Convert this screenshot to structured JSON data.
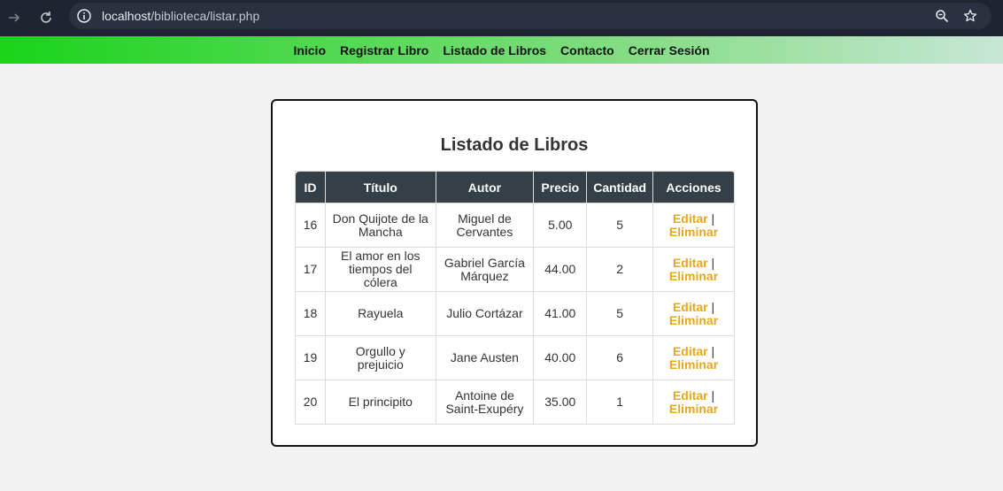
{
  "browser": {
    "url_host": "localhost",
    "url_path": "/biblioteca/listar.php"
  },
  "nav": {
    "items": [
      "Inicio",
      "Registrar Libro",
      "Listado de Libros",
      "Contacto",
      "Cerrar Sesión"
    ]
  },
  "main": {
    "title": "Listado de Libros",
    "columns": [
      "ID",
      "Título",
      "Autor",
      "Precio",
      "Cantidad",
      "Acciones"
    ],
    "rows": [
      {
        "id": "16",
        "titulo": "Don Quijote de la Mancha",
        "autor": "Miguel de Cervantes",
        "precio": "5.00",
        "cantidad": "5"
      },
      {
        "id": "17",
        "titulo": "El amor en los tiempos del cólera",
        "autor": "Gabriel García Márquez",
        "precio": "44.00",
        "cantidad": "2"
      },
      {
        "id": "18",
        "titulo": "Rayuela",
        "autor": "Julio Cortázar",
        "precio": "41.00",
        "cantidad": "5"
      },
      {
        "id": "19",
        "titulo": "Orgullo y prejuicio",
        "autor": "Jane Austen",
        "precio": "40.00",
        "cantidad": "6"
      },
      {
        "id": "20",
        "titulo": "El principito",
        "autor": "Antoine de Saint-Exupéry",
        "precio": "35.00",
        "cantidad": "1"
      }
    ],
    "actions": {
      "edit": "Editar",
      "separator": "|",
      "delete": "Eliminar"
    }
  },
  "colors": {
    "header_bg": "#343f48",
    "action_link": "#e6a817",
    "nav_gradient_start": "#1ad31a"
  },
  "icons": [
    "forward-icon",
    "reload-icon",
    "info-icon",
    "zoom-icon",
    "star-icon"
  ]
}
